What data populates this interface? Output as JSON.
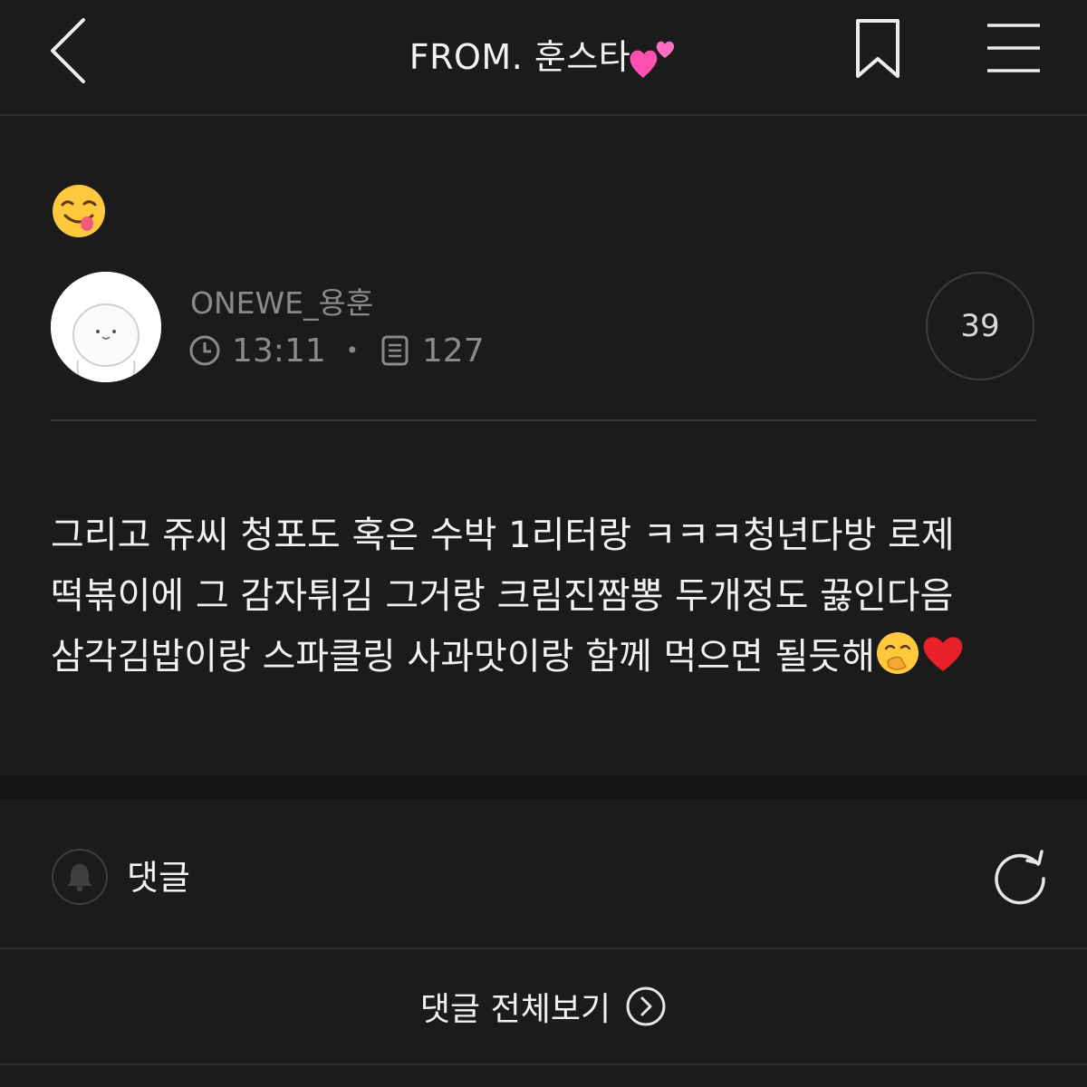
{
  "header": {
    "title": "FROM. 훈스타",
    "title_emoji": "two-hearts-icon",
    "back_icon": "chevron-left-icon",
    "bookmark_icon": "bookmark-icon",
    "menu_icon": "hamburger-menu-icon"
  },
  "post": {
    "leading_emoji": "savoring-food-face-icon",
    "author": {
      "name": "ONEWE_용훈",
      "time": "13:11",
      "post_count": "127",
      "time_icon": "clock-icon",
      "count_icon": "document-icon"
    },
    "like_count": "39",
    "body_lines": [
      "그리고 쥬씨 청포도 혹은 수박 1리터랑 ㅋㅋㅋ청년다방 로제",
      "떡볶이에 그 감자튀김 그거랑 크림진짬뽕 두개정도 끓인다음",
      "삼각김밥이랑 스파클링 사과맛이랑 함께 먹으면 될듯해"
    ],
    "trailing_emojis": [
      "hand-over-mouth-face-icon",
      "red-heart-icon"
    ]
  },
  "comments": {
    "label": "댓글",
    "bell_icon": "bell-icon",
    "refresh_icon": "refresh-icon",
    "view_all_label": "댓글 전체보기",
    "view_all_icon": "chevron-right-circle-icon"
  },
  "colors": {
    "background": "#1b1b1b",
    "text": "#f2f2f2",
    "muted": "#8a8a8a",
    "divider": "#3a3a3a"
  }
}
